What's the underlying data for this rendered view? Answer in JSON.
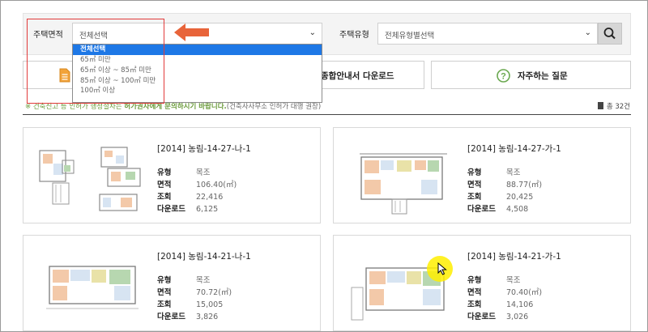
{
  "filters": {
    "area_label": "주택면적",
    "area_selected": "전체선택",
    "type_label": "주택유형",
    "type_selected": "전체유형별선택"
  },
  "area_options": [
    "전체선택",
    "65㎡ 미만",
    "65㎡ 이상 ~ 85㎡ 미만",
    "85㎡ 이상 ~ 100㎡ 미만",
    "100㎡ 이상"
  ],
  "buttons": {
    "download_guide": "종합안내서 다운로드",
    "faq": "자주하는 질문"
  },
  "notice": {
    "prefix": "※ 건축신고 등 인허가 행정절차는 ",
    "highlight": "허가권자에게 문의하시기 바랍니다.",
    "suffix": "(건축사사무소 인허가 대행 권장)"
  },
  "total": "총 32건",
  "card_keys": {
    "type": "유형",
    "area": "면적",
    "views": "조회",
    "downloads": "다운로드"
  },
  "cards": [
    {
      "title": "[2014] 농림-14-27-나-1",
      "type": "목조",
      "area": "106.40(㎡)",
      "views": "22,416",
      "downloads": "6,125"
    },
    {
      "title": "[2014] 농림-14-27-가-1",
      "type": "목조",
      "area": "88.77(㎡)",
      "views": "20,425",
      "downloads": "4,508"
    },
    {
      "title": "[2014] 농림-14-21-나-1",
      "type": "목조",
      "area": "70.72(㎡)",
      "views": "15,005",
      "downloads": "3,826"
    },
    {
      "title": "[2014] 농림-14-21-가-1",
      "type": "목조",
      "area": "70.40(㎡)",
      "views": "14,106",
      "downloads": "3,026"
    }
  ],
  "colors": {
    "selected_option": "#1e78e6",
    "annotation_red": "#e23b3b",
    "arrow_orange": "#e8643a",
    "cursor_highlight": "#ffee00"
  }
}
